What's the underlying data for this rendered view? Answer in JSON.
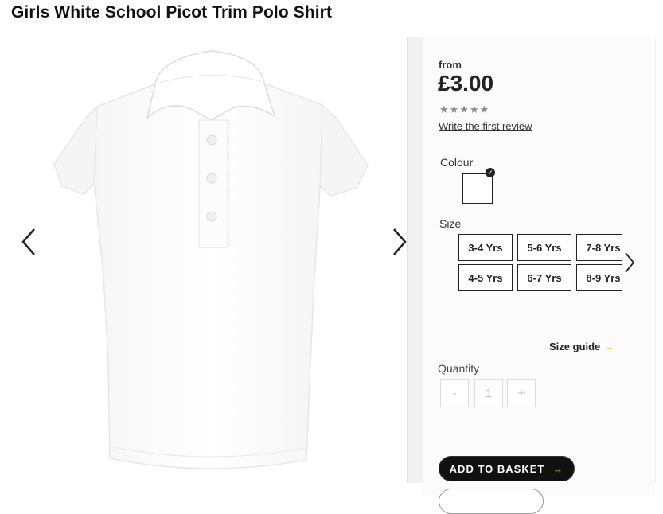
{
  "product": {
    "title": "Girls White School Picot Trim Polo Shirt"
  },
  "pricing": {
    "from_label": "from",
    "price": "£3.00"
  },
  "rating": {
    "stars": "★★★★★",
    "review_link": "Write the first review"
  },
  "colour": {
    "label": "Colour",
    "selected": "White",
    "swatch_color": "#ffffff"
  },
  "size": {
    "label": "Size",
    "options": [
      "3-4 Yrs",
      "5-6 Yrs",
      "7-8 Yrs",
      "4-5 Yrs",
      "6-7 Yrs",
      "8-9 Yrs"
    ]
  },
  "size_guide": {
    "label": "Size guide",
    "arrow": "→"
  },
  "quantity": {
    "label": "Quantity",
    "minus": "-",
    "value": "1",
    "plus": "+"
  },
  "basket": {
    "label": "ADD TO BASKET",
    "arrow": "→"
  },
  "colors": {
    "accent": "#f5c400",
    "button": "#111111"
  }
}
